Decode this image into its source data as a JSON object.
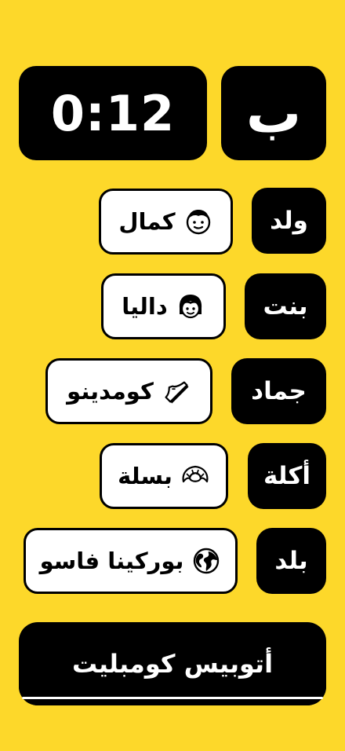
{
  "header": {
    "timer": "0:12",
    "letter": "ب"
  },
  "rows": [
    {
      "category": "ولد",
      "answer": "كمال",
      "icon": "boy-face-icon"
    },
    {
      "category": "بنت",
      "answer": "داليا",
      "icon": "girl-face-icon"
    },
    {
      "category": "جماد",
      "answer": "كومدينو",
      "icon": "sneaker-icon"
    },
    {
      "category": "أكلة",
      "answer": "بسلة",
      "icon": "croissant-icon"
    },
    {
      "category": "بلد",
      "answer": "بوركينا فاسو",
      "icon": "globe-icon"
    }
  ],
  "submit_label": "أتوبيس كومبليت",
  "colors": {
    "background": "#fdd82a",
    "dark": "#000000",
    "light": "#ffffff"
  }
}
